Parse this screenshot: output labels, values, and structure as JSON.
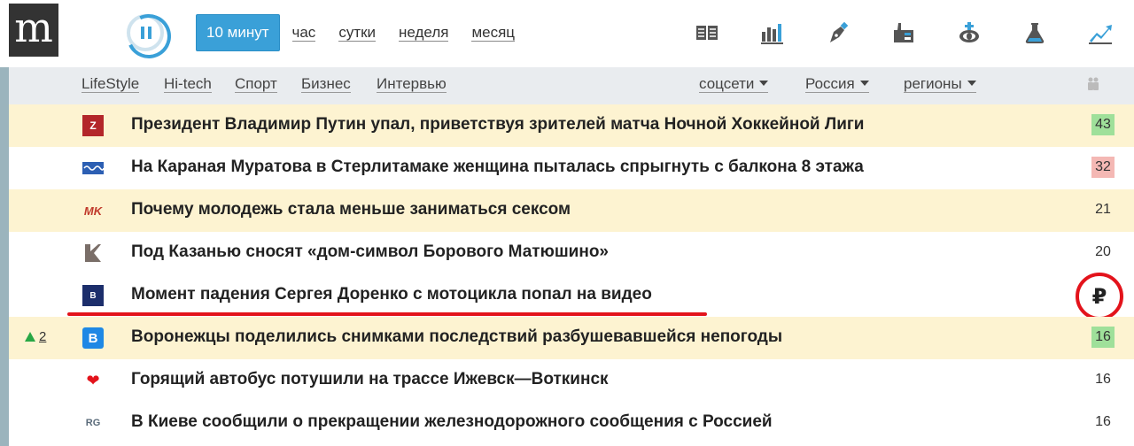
{
  "logo": {
    "letter": "m"
  },
  "periods": [
    {
      "label": "10 минут",
      "active": true
    },
    {
      "label": "час",
      "active": false
    },
    {
      "label": "сутки",
      "active": false
    },
    {
      "label": "неделя",
      "active": false
    },
    {
      "label": "месяц",
      "active": false
    }
  ],
  "category_icons": [
    "newspaper-icon",
    "bar-chart-icon",
    "pen-nib-icon",
    "factory-icon",
    "globe-crown-icon",
    "flask-icon",
    "trend-up-icon"
  ],
  "subnav": {
    "topics": [
      "LifeStyle",
      "Hi-tech",
      "Спорт",
      "Бизнес",
      "Интервью"
    ],
    "dropdowns": [
      "соцсети",
      "Россия",
      "регионы"
    ]
  },
  "news": [
    {
      "source_icon": "z-logo",
      "source_glyph": "Z",
      "title": "Президент Владимир Путин упал, приветствуя зрителей матча Ночной Хоккейной Лиги",
      "count": "43",
      "count_style": "green",
      "highlight": true,
      "rank_change": ""
    },
    {
      "source_icon": "wave-logo",
      "source_glyph": "",
      "title": "На Караная Муратова в Стерлитамаке женщина пыталась спрыгнуть с балкона 8 этажа",
      "count": "32",
      "count_style": "red",
      "highlight": false,
      "rank_change": ""
    },
    {
      "source_icon": "mk-logo",
      "source_glyph": "MK",
      "title": "Почему молодежь стала меньше заниматься сексом",
      "count": "21",
      "count_style": "",
      "highlight": true,
      "rank_change": ""
    },
    {
      "source_icon": "k-logo",
      "source_glyph": "",
      "title": "Под Казанью сносят «дом-символ Борового Матюшино»",
      "count": "20",
      "count_style": "",
      "highlight": false,
      "rank_change": ""
    },
    {
      "source_icon": "bm-logo",
      "source_glyph": "B",
      "title": "Момент падения Сергея Доренко с мотоцикла попал на видео",
      "count": "₽",
      "count_style": "ruble",
      "highlight": false,
      "rank_change": ""
    },
    {
      "source_icon": "v-logo",
      "source_glyph": "B",
      "title": "Воронежцы поделились снимками последствий разбушевавшейся непогоды",
      "count": "16",
      "count_style": "green",
      "highlight": true,
      "rank_change": "2"
    },
    {
      "source_icon": "heart-icon",
      "source_glyph": "❤",
      "title": "Горящий автобус потушили на трассе Ижевск—Воткинск",
      "count": "16",
      "count_style": "",
      "highlight": false,
      "rank_change": ""
    },
    {
      "source_icon": "rg-logo",
      "source_glyph": "RG",
      "title": "В Киеве сообщили о прекращении железнодорожного сообщения с Россией",
      "count": "16",
      "count_style": "",
      "highlight": false,
      "rank_change": ""
    }
  ],
  "colors": {
    "accent": "#3aa0d8",
    "highlight_row": "#fdf3d1",
    "count_up": "#9fe09a",
    "count_down": "#f4b8b4",
    "annotation_red": "#e3131b"
  }
}
